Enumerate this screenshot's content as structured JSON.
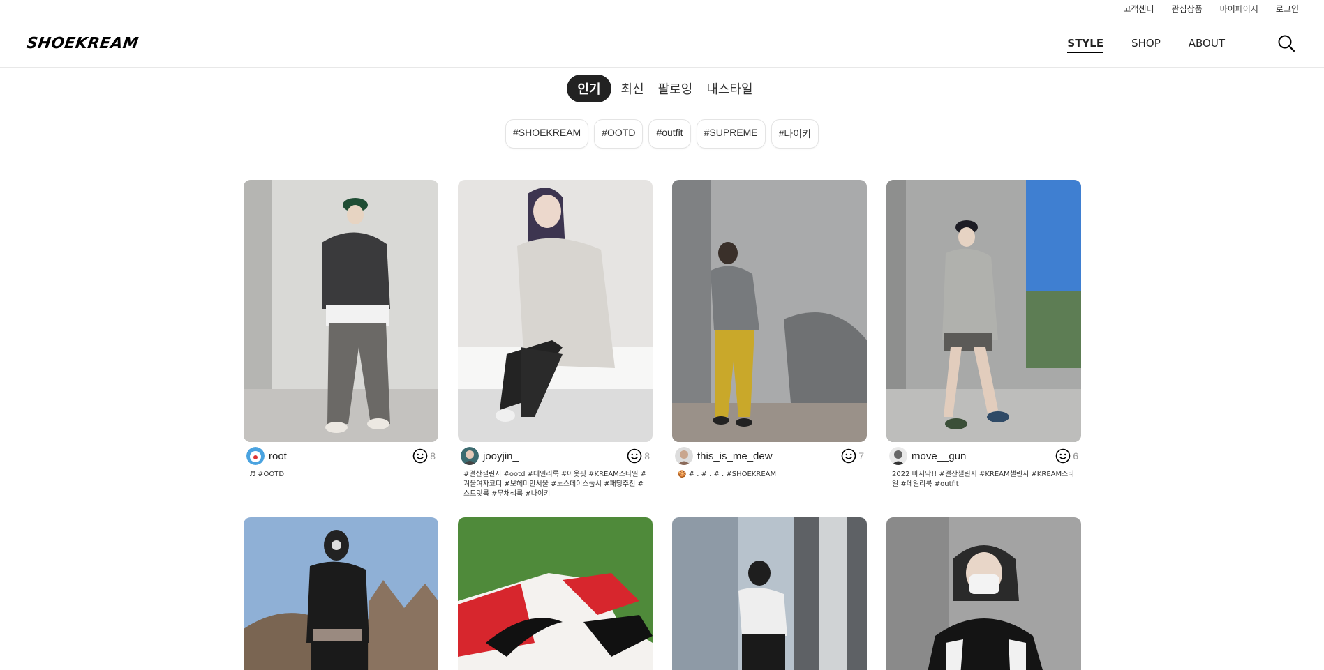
{
  "util_links": [
    "고객센터",
    "관심상품",
    "마이페이지",
    "로그인"
  ],
  "logo": "SHOEKREAM",
  "nav": [
    {
      "label": "STYLE",
      "active": true
    },
    {
      "label": "SHOP",
      "active": false
    },
    {
      "label": "ABOUT",
      "active": false
    }
  ],
  "tabs": [
    {
      "label": "인기",
      "active": true
    },
    {
      "label": "최신",
      "active": false
    },
    {
      "label": "팔로잉",
      "active": false
    },
    {
      "label": "내스타일",
      "active": false
    }
  ],
  "hashtags": [
    "#SHOEKREAM",
    "#OOTD",
    "#outfit",
    "#SUPREME",
    "#나이키"
  ],
  "posts": [
    {
      "username": "root",
      "likes": "8",
      "caption": "♬ #OOTD"
    },
    {
      "username": "jooyjin_",
      "likes": "8",
      "caption": "#결산챌린지 #ootd #데일리룩 #아웃핏 #KREAM스타일 #겨울여자코디 #보헤미안서울 #노스페이스눕시 #패딩추천 #스트릿룩 #무채색룩 #나이키"
    },
    {
      "username": "this_is_me_dew",
      "likes": "7",
      "caption": "🍪 # . # . # . #SHOEKREAM"
    },
    {
      "username": "move__gun",
      "likes": "6",
      "caption": "2022 마지막!! #결산챌린지 #KREAM챌린지 #KREAM스타일 #데일리룩 #outfit"
    },
    {
      "username": "",
      "likes": "",
      "caption": ""
    },
    {
      "username": "",
      "likes": "",
      "caption": ""
    },
    {
      "username": "",
      "likes": "",
      "caption": ""
    },
    {
      "username": "",
      "likes": "",
      "caption": ""
    }
  ],
  "colors": {
    "accent": "#222222",
    "chip_border": "#e4e4e4",
    "muted": "#999999"
  }
}
